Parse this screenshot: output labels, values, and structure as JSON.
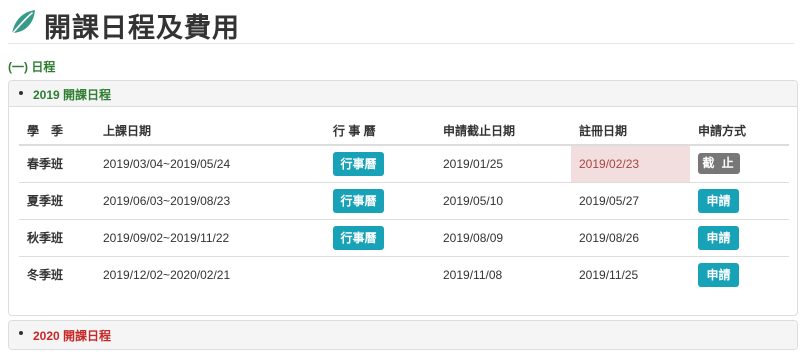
{
  "page": {
    "title": "開課日程及費用",
    "icon": "leaf-icon",
    "accent_color": "#3a9a8a"
  },
  "section": {
    "label": "(一) 日程"
  },
  "panels": [
    {
      "title": "2019 開課日程",
      "title_color": "#2e7d32",
      "expanded": true,
      "table": {
        "headers": [
          "學　季",
          "上課日期",
          "行 事 曆",
          "申請截止日期",
          "註冊日期",
          "申請方式"
        ],
        "rows": [
          {
            "term": "春季班",
            "dates": "2019/03/04~2019/05/24",
            "calendar_label": "行事曆",
            "deadline": "2019/01/25",
            "registration": "2019/02/23",
            "registration_highlight": true,
            "apply_label": "截 止",
            "apply_state": "closed"
          },
          {
            "term": "夏季班",
            "dates": "2019/06/03~2019/08/23",
            "calendar_label": "行事曆",
            "deadline": "2019/05/10",
            "registration": "2019/05/27",
            "registration_highlight": false,
            "apply_label": "申請",
            "apply_state": "open"
          },
          {
            "term": "秋季班",
            "dates": "2019/09/02~2019/11/22",
            "calendar_label": "行事曆",
            "deadline": "2019/08/09",
            "registration": "2019/08/26",
            "registration_highlight": false,
            "apply_label": "申請",
            "apply_state": "open"
          },
          {
            "term": "冬季班",
            "dates": "2019/12/02~2020/02/21",
            "calendar_label": "",
            "deadline": "2019/11/08",
            "registration": "2019/11/25",
            "registration_highlight": false,
            "apply_label": "申請",
            "apply_state": "open"
          }
        ]
      }
    },
    {
      "title": "2020 開課日程",
      "title_color": "#c62828",
      "expanded": false
    }
  ],
  "colors": {
    "button_primary": "#17a2b8",
    "button_closed": "#777777",
    "highlight_bg": "#f2dede",
    "highlight_text": "#a94442"
  }
}
